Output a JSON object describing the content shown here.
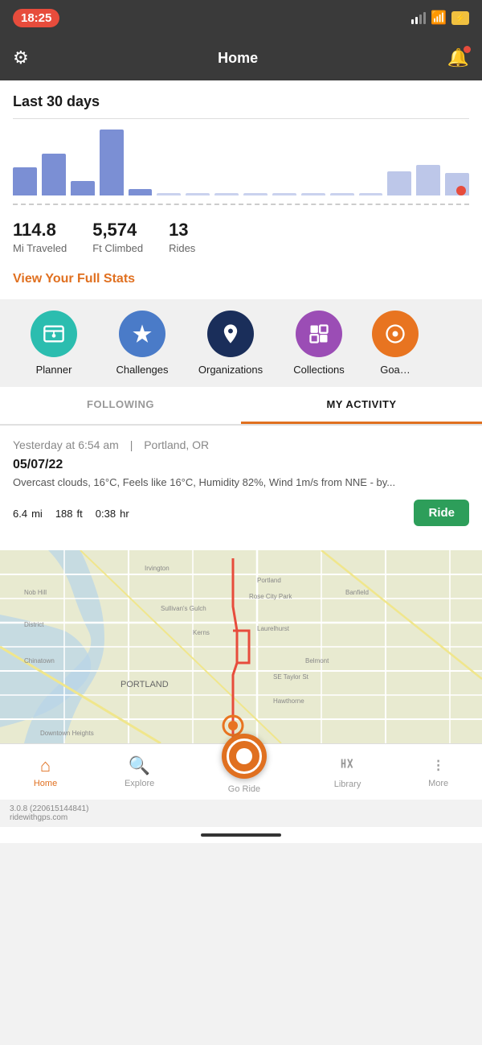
{
  "statusBar": {
    "time": "18:25"
  },
  "topNav": {
    "title": "Home"
  },
  "stats": {
    "sectionTitle": "Last 30 days",
    "viewStatsLabel": "View Your Full Stats",
    "metrics": [
      {
        "value": "114.8",
        "label": "Mi Traveled"
      },
      {
        "value": "5,574",
        "label": "Ft Climbed"
      },
      {
        "value": "13",
        "label": "Rides"
      }
    ],
    "chartBars": [
      30,
      55,
      20,
      85,
      10,
      0,
      0,
      0,
      0,
      0,
      0,
      0,
      0,
      35,
      45,
      35
    ]
  },
  "quickActions": [
    {
      "id": "planner",
      "label": "Planner",
      "iconColor": "icon-teal",
      "icon": "🗺"
    },
    {
      "id": "challenges",
      "label": "Challenges",
      "iconColor": "icon-blue",
      "icon": "🏆"
    },
    {
      "id": "organizations",
      "label": "Organizations",
      "iconColor": "icon-navy",
      "icon": "📍"
    },
    {
      "id": "collections",
      "label": "Collections",
      "iconColor": "icon-purple",
      "icon": "❐"
    },
    {
      "id": "goals",
      "label": "Goa…",
      "iconColor": "icon-orange",
      "icon": "🎯"
    }
  ],
  "tabs": [
    {
      "id": "following",
      "label": "FOLLOWING",
      "active": false
    },
    {
      "id": "my-activity",
      "label": "MY ACTIVITY",
      "active": true
    }
  ],
  "activity": {
    "meta": "Yesterday at 6:54 am",
    "location": "Portland, OR",
    "date": "05/07/22",
    "weather": "Overcast clouds, 16°C, Feels like 16°C, Humidity 82%, Wind 1m/s from NNE - by...",
    "distance": "6.4",
    "distanceUnit": "mi",
    "elevation": "188",
    "elevationUnit": "ft",
    "time": "0:38",
    "timeUnit": "hr",
    "rideButton": "Ride"
  },
  "bottomNav": [
    {
      "id": "home",
      "label": "Home",
      "active": true
    },
    {
      "id": "explore",
      "label": "Explore",
      "active": false
    },
    {
      "id": "go-ride",
      "label": "Go Ride",
      "active": false,
      "special": true
    },
    {
      "id": "library",
      "label": "Library",
      "active": false
    },
    {
      "id": "more",
      "label": "More",
      "active": false
    }
  ],
  "appVersion": {
    "version": "3.0.8 (220615144841)",
    "website": "ridewithgps.com"
  }
}
